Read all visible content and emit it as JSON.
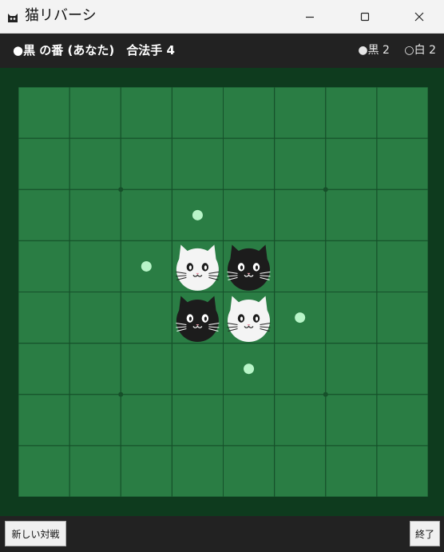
{
  "window": {
    "title": "猫リバーシ"
  },
  "status": {
    "turn_text": "●黒 の番 (あなた)　合法手 4",
    "black_count": "●黒 2",
    "white_count": "○白 2"
  },
  "board": {
    "size": 8,
    "pieces": [
      {
        "row": 3,
        "col": 3,
        "color": "white"
      },
      {
        "row": 3,
        "col": 4,
        "color": "black"
      },
      {
        "row": 4,
        "col": 3,
        "color": "black"
      },
      {
        "row": 4,
        "col": 4,
        "color": "white"
      }
    ],
    "legal_moves": [
      {
        "row": 2,
        "col": 3
      },
      {
        "row": 3,
        "col": 2
      },
      {
        "row": 4,
        "col": 5
      },
      {
        "row": 5,
        "col": 4
      }
    ],
    "star_points": [
      {
        "row": 2,
        "col": 2
      },
      {
        "row": 2,
        "col": 6
      },
      {
        "row": 6,
        "col": 2
      },
      {
        "row": 6,
        "col": 6
      }
    ],
    "colors": {
      "board": "#2a7d44",
      "grid": "#16502a",
      "frame": "#0e3b1e",
      "hint": "#b8f5c8",
      "black_cat": "#1c1c1c",
      "white_cat": "#f4f4f4"
    }
  },
  "footer": {
    "new_game_label": "新しい対戦",
    "quit_label": "終了"
  }
}
